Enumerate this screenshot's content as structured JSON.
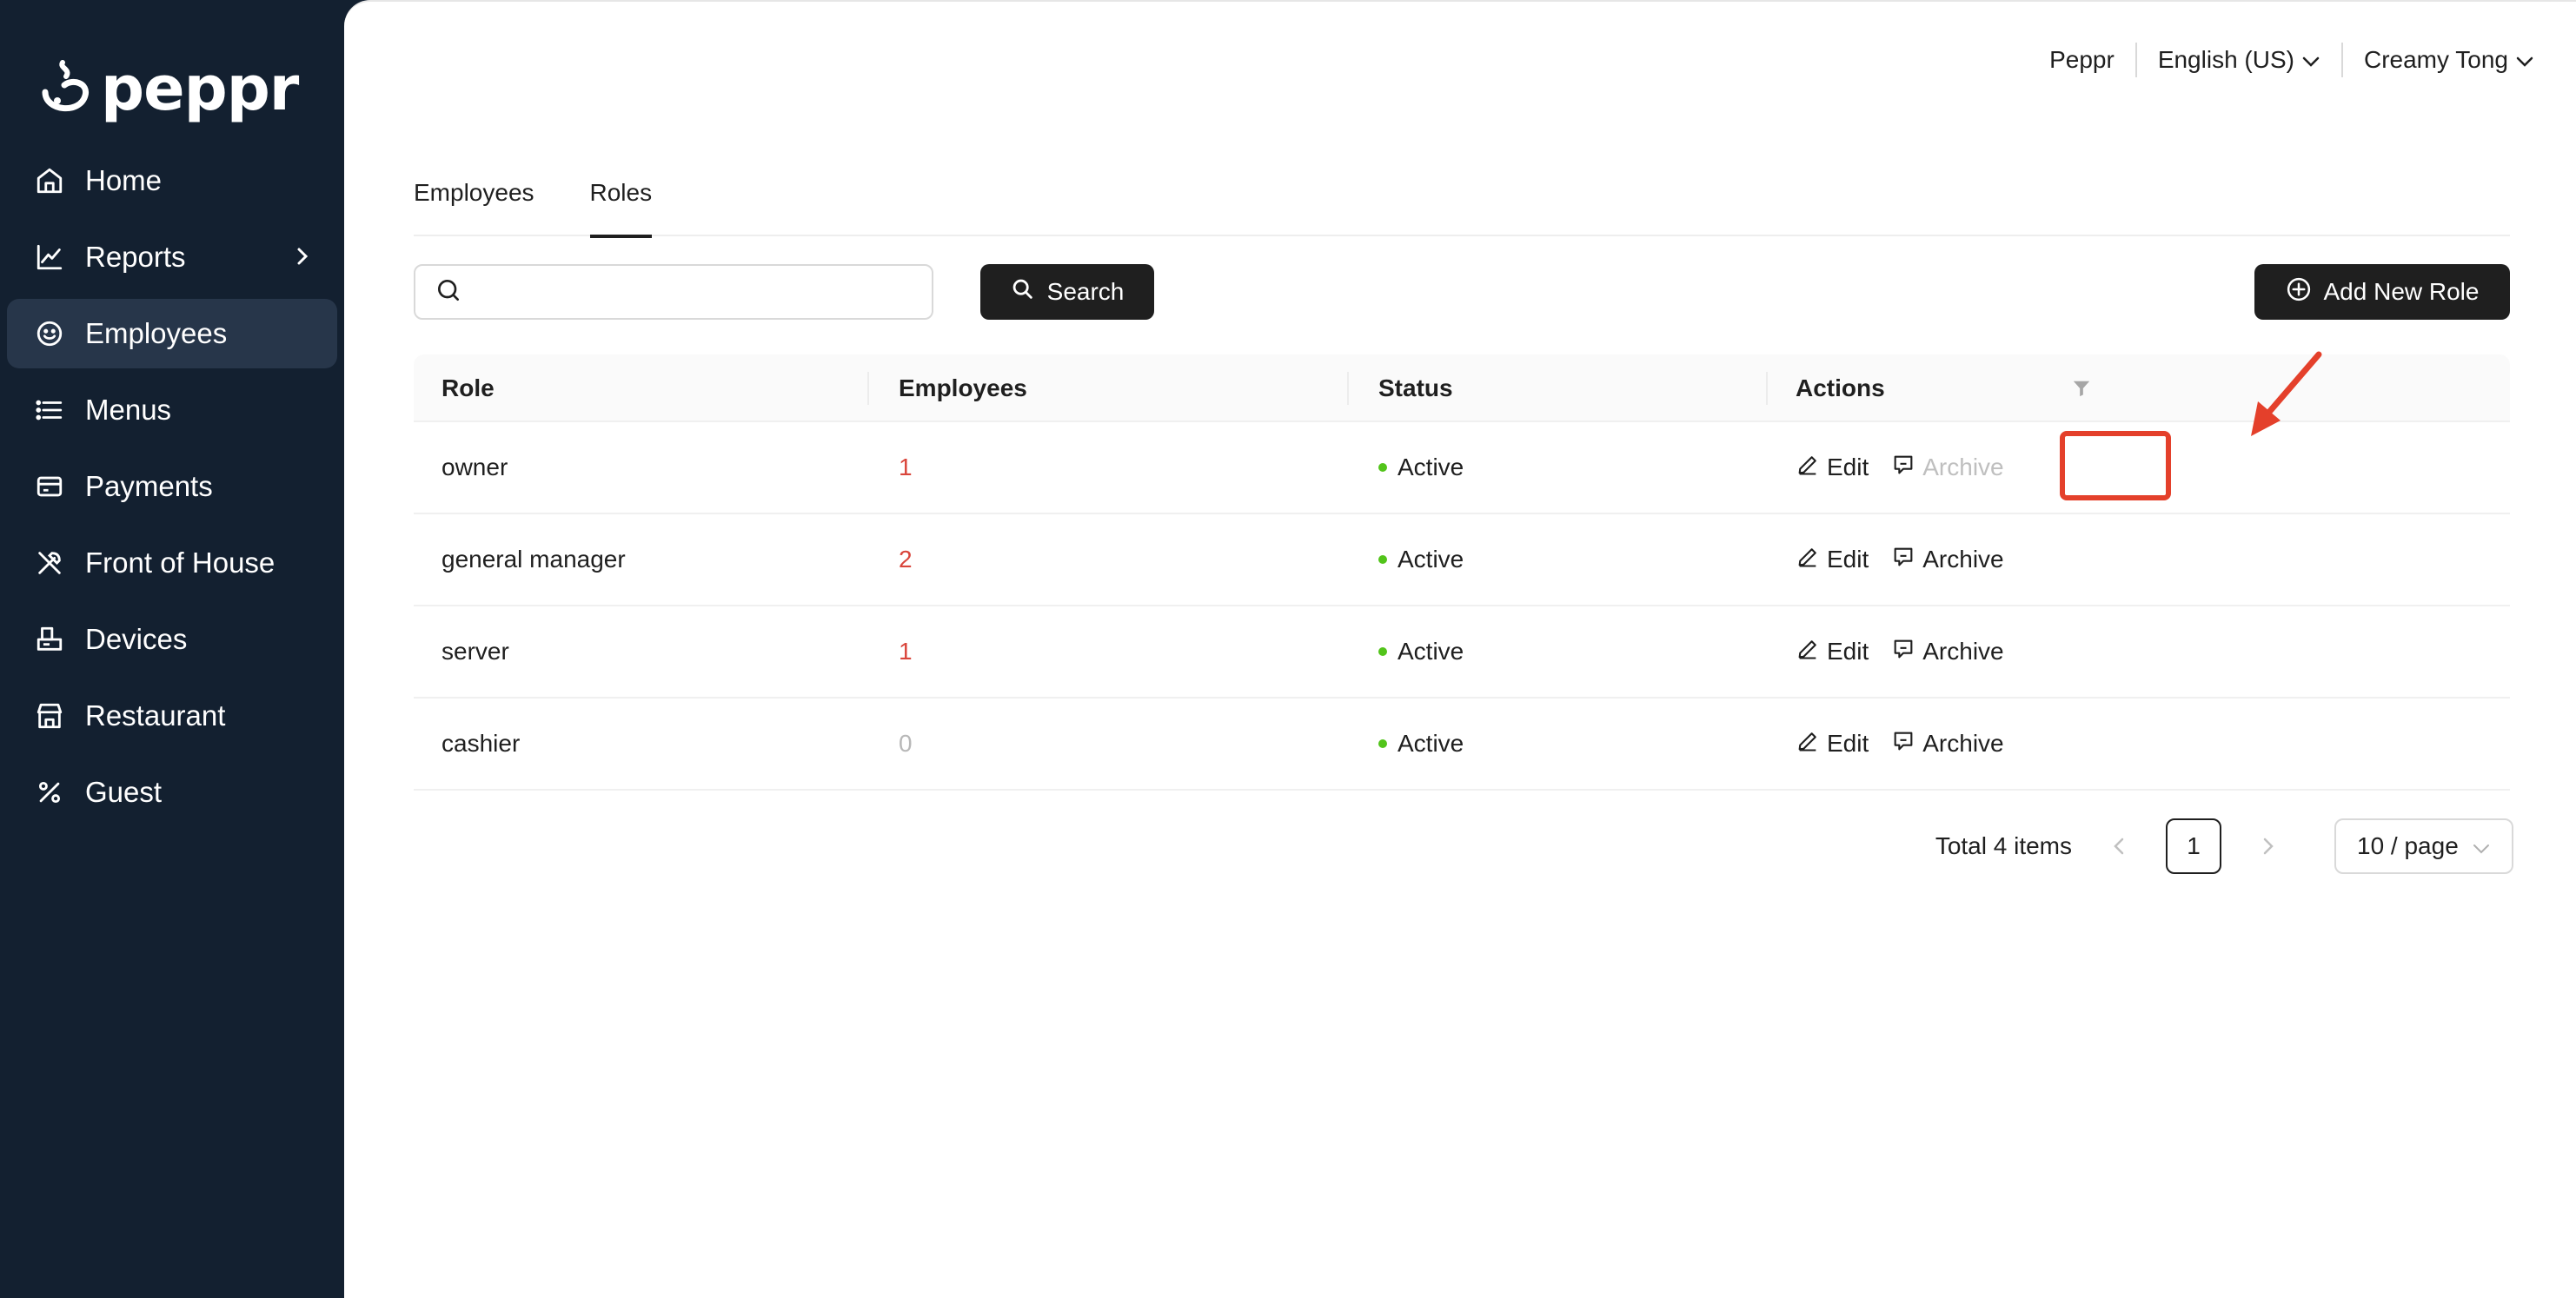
{
  "brand": {
    "name": "peppr"
  },
  "sidebar": {
    "items": [
      {
        "label": "Home",
        "icon": "home-icon"
      },
      {
        "label": "Reports",
        "icon": "chart-line-icon",
        "has_submenu": true
      },
      {
        "label": "Employees",
        "icon": "smile-icon",
        "active": true
      },
      {
        "label": "Menus",
        "icon": "list-icon"
      },
      {
        "label": "Payments",
        "icon": "card-icon"
      },
      {
        "label": "Front of House",
        "icon": "utensils-icon"
      },
      {
        "label": "Devices",
        "icon": "device-icon"
      },
      {
        "label": "Restaurant",
        "icon": "shop-icon"
      },
      {
        "label": "Guest",
        "icon": "percent-icon"
      }
    ]
  },
  "topbar": {
    "org": "Peppr",
    "language": "English (US)",
    "user": "Creamy Tong"
  },
  "tabs": [
    {
      "label": "Employees",
      "active": false
    },
    {
      "label": "Roles",
      "active": true
    }
  ],
  "search": {
    "value": "",
    "placeholder": "",
    "button_label": "Search"
  },
  "add_button_label": "Add New Role",
  "table": {
    "columns": [
      "Role",
      "Employees",
      "Status",
      "Actions"
    ],
    "rows": [
      {
        "role": "owner",
        "employees": "1",
        "status": "Active",
        "edit": "Edit",
        "archive": "Archive",
        "archive_disabled": true
      },
      {
        "role": "general manager",
        "employees": "2",
        "status": "Active",
        "edit": "Edit",
        "archive": "Archive",
        "archive_disabled": false
      },
      {
        "role": "server",
        "employees": "1",
        "status": "Active",
        "edit": "Edit",
        "archive": "Archive",
        "archive_disabled": false
      },
      {
        "role": "cashier",
        "employees": "0",
        "status": "Active",
        "edit": "Edit",
        "archive": "Archive",
        "archive_disabled": false
      }
    ]
  },
  "pagination": {
    "total_text": "Total 4 items",
    "current_page": "1",
    "page_size": "10 / page"
  },
  "colors": {
    "sidebar_bg": "#132030",
    "active_nav_bg": "#27364a",
    "primary_dark": "#1f1f1f",
    "count_red": "#d9453b",
    "status_green": "#52c41a",
    "annotation_red": "#e4402b"
  }
}
